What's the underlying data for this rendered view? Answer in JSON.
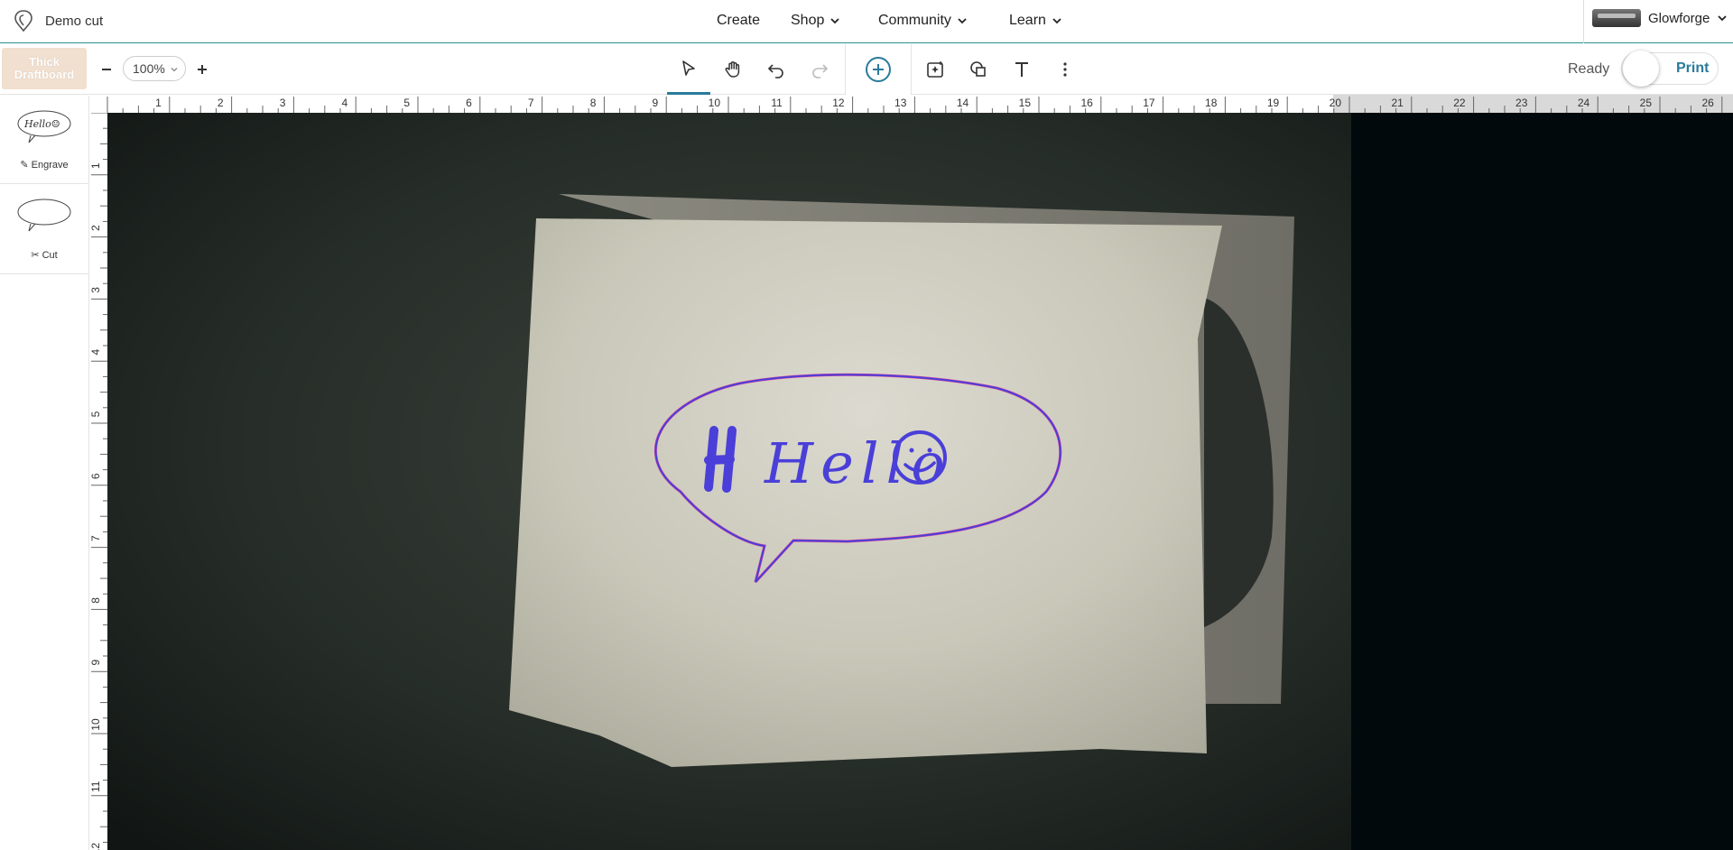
{
  "header": {
    "doc_title": "Demo cut",
    "nav": [
      {
        "label": "Create",
        "dropdown": false
      },
      {
        "label": "Shop",
        "dropdown": true
      },
      {
        "label": "Community",
        "dropdown": true
      },
      {
        "label": "Learn",
        "dropdown": true
      }
    ],
    "account_label": "Glowforge"
  },
  "toolbar": {
    "material_line1": "Thick",
    "material_line2": "Draftboard",
    "zoom_value": "100%",
    "status": "Ready",
    "print_label": "Print"
  },
  "designs": [
    {
      "operation": "Engrave",
      "thumb_text": "Hello☺"
    },
    {
      "operation": "Cut"
    }
  ],
  "ruler": {
    "horizontal_labels": [
      "1",
      "2",
      "3",
      "4",
      "5",
      "6",
      "7",
      "8",
      "9",
      "10",
      "11",
      "12",
      "13",
      "14",
      "15",
      "16",
      "17",
      "18",
      "19",
      "20",
      "21",
      "22",
      "23",
      "24",
      "25",
      "26"
    ],
    "vertical_labels": [
      "1",
      "2",
      "3",
      "4",
      "5",
      "6",
      "7",
      "8",
      "9",
      "10",
      "11",
      "12"
    ]
  },
  "canvas": {
    "artwork_text": "Hello",
    "colors": {
      "artwork_stroke": "#4a3fd8",
      "cut_outline": "#e0409a",
      "bed": "#1e2620",
      "paper": "#c9c8bb"
    }
  }
}
